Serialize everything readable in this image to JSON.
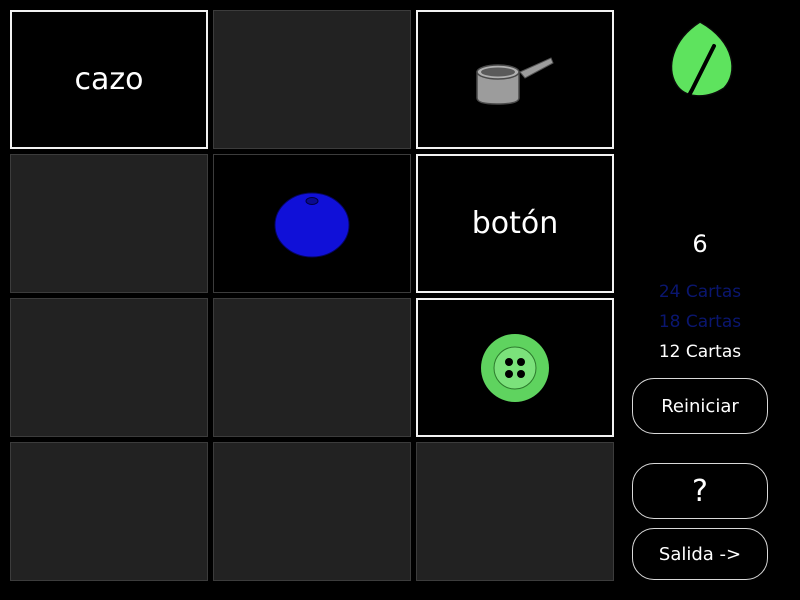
{
  "cards": [
    {
      "id": "c1",
      "state": "open",
      "word": "cazo"
    },
    {
      "id": "c2",
      "state": "hidden"
    },
    {
      "id": "c3",
      "state": "open",
      "icon": "saucepan-icon"
    },
    {
      "id": "c4",
      "state": "hidden"
    },
    {
      "id": "c5",
      "state": "open",
      "icon": "blueberry-icon"
    },
    {
      "id": "c6",
      "state": "open",
      "word": "botón"
    },
    {
      "id": "c7",
      "state": "hidden"
    },
    {
      "id": "c8",
      "state": "hidden"
    },
    {
      "id": "c9",
      "state": "open",
      "icon": "button-icon"
    },
    {
      "id": "c10",
      "state": "hidden"
    },
    {
      "id": "c11",
      "state": "hidden"
    },
    {
      "id": "c12",
      "state": "hidden"
    }
  ],
  "sidebar": {
    "logo": "leaf-icon",
    "count": "6",
    "options": [
      "24 Cartas",
      "18 Cartas",
      "12 Cartas"
    ],
    "selected_option": "12 Cartas",
    "restart_label": "Reiniciar",
    "help_label": "?",
    "exit_label": "Salida ->"
  },
  "colors": {
    "leaf": "#5ee35e",
    "blueberry": "#1010d8",
    "button_icon": "#5fd35f",
    "pan": "#9c9c9c",
    "dim_option": "#0a1670"
  }
}
